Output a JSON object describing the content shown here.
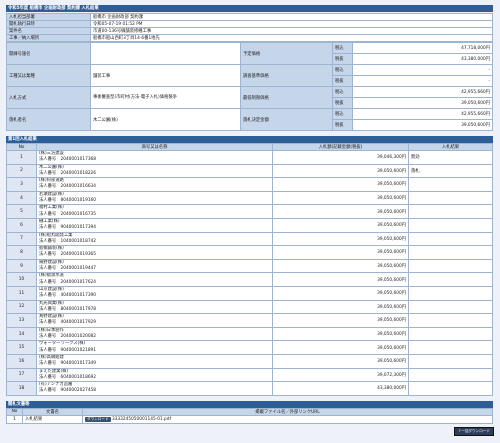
{
  "title": "令和5年度 船橋市 企画財政部 契約課 入札結果",
  "info": [
    {
      "label": "入札担当部署",
      "value": "船橋市 企画財政部 契約課"
    },
    {
      "label": "開札執行日時",
      "value": "令和05-07-19 01:52 PM"
    },
    {
      "label": "案件名",
      "value": "市道00-136号線舗装修繕工事"
    },
    {
      "label": "工事／納入場所",
      "value": "船橋市船山西町3丁目14-6番1地先"
    }
  ],
  "detail": {
    "bid_number_label": "開練号施名",
    "bid_number_value": "",
    "type_label": "工種又は業種",
    "type_value": "舗装工事",
    "method_label": "入札方式",
    "method_value": "事後審査型(市町村(方法-電子入札)価格競争",
    "winner_label": "落札者名",
    "winner_value": "木二公園(株)",
    "planned_label": "予定価格",
    "planned_incl": "47,718,000円",
    "planned_excl": "43,380,000円",
    "survey_label": "調査基準価格",
    "survey_incl": "-",
    "survey_excl": "-",
    "min_label": "最低制限価格",
    "min_incl": "42,955,660円",
    "min_excl": "39,050,600円",
    "award_label": "落札決定金額",
    "award_incl": "42,955,660円",
    "award_excl": "39,050,600円",
    "tax_in": "税込",
    "tax_ex": "税抜"
  },
  "round_title": "第1回入札結果",
  "cols": {
    "no": "No",
    "name": "商号又は名称",
    "amount": "入札額(記載金額(税抜)",
    "result": "入札結果"
  },
  "bidders": [
    {
      "no": "1",
      "name": "(株)三浩建設",
      "corp": "法人番号　2040001017368",
      "amount": "39,046,300円",
      "result": "無効"
    },
    {
      "no": "2",
      "name": "木二公園(株)",
      "corp": "法人番号　2040001018226",
      "amount": "39,050,600円",
      "result": "落札"
    },
    {
      "no": "3",
      "name": "(株)阿部道路",
      "corp": "法人番号　2040001016634",
      "amount": "39,050,600円",
      "result": ""
    },
    {
      "no": "4",
      "name": "若瀬建設(株)",
      "corp": "法人番号　8040001019160",
      "amount": "39,050,600円",
      "result": ""
    },
    {
      "no": "5",
      "name": "福村工業(株)",
      "corp": "法人番号　2040001016735",
      "amount": "39,050,600円",
      "result": ""
    },
    {
      "no": "6",
      "name": "樋工業(株)",
      "corp": "法人番号　9040001017394",
      "amount": "39,050,600円",
      "result": ""
    },
    {
      "no": "7",
      "name": "(株)船丸開発工業",
      "corp": "法人番号　1040001018742",
      "amount": "39,050,600円",
      "result": ""
    },
    {
      "no": "8",
      "name": "船橋鋪装(株)",
      "corp": "法人番号　2040001019365",
      "amount": "39,050,600円",
      "result": ""
    },
    {
      "no": "9",
      "name": "陽野建設(株)",
      "corp": "法人番号　2040001019447",
      "amount": "39,050,600円",
      "result": ""
    },
    {
      "no": "10",
      "name": "(株)猿渡水道",
      "corp": "法人番号　2040001017624",
      "amount": "39,050,600円",
      "result": ""
    },
    {
      "no": "11",
      "name": "山京建設(株)",
      "corp": "法人番号　4040001017390",
      "amount": "39,050,600円",
      "result": ""
    },
    {
      "no": "12",
      "name": "丸光興業(株)",
      "corp": "法人番号　8040001017978",
      "amount": "39,050,600円",
      "result": ""
    },
    {
      "no": "13",
      "name": "真野建設(株)",
      "corp": "法人番号　4040001017929",
      "amount": "39,050,600円",
      "result": ""
    },
    {
      "no": "14",
      "name": "(株)日本創作",
      "corp": "法人番号　2040001020082",
      "amount": "39,050,600円",
      "result": ""
    },
    {
      "no": "15",
      "name": "ウォーターワークス(株)",
      "corp": "法人番号　9040001021891",
      "amount": "39,050,600円",
      "result": ""
    },
    {
      "no": "16",
      "name": "(株)高橋組建",
      "corp": "法人番号　9040001017349",
      "amount": "39,050,600円",
      "result": ""
    },
    {
      "no": "17",
      "name": "まえだ建業(株)",
      "corp": "法人番号　6040001018692",
      "amount": "39,072,300円",
      "result": ""
    },
    {
      "no": "18",
      "name": "(有)アンナカ造園",
      "corp": "法人番号　9040002027458",
      "amount": "43,380,000円",
      "result": ""
    }
  ],
  "docs_title": "開札文書等",
  "doc_cols": {
    "no": "No",
    "name": "文書名",
    "file": "掲載ファイル名／外部リンクURL"
  },
  "docs": [
    {
      "no": "1",
      "name": "入札結果",
      "btn": "ダウンロード",
      "file": "3333245050001145-01.pdf"
    }
  ],
  "top_btn": "↑一括ダウンロード"
}
